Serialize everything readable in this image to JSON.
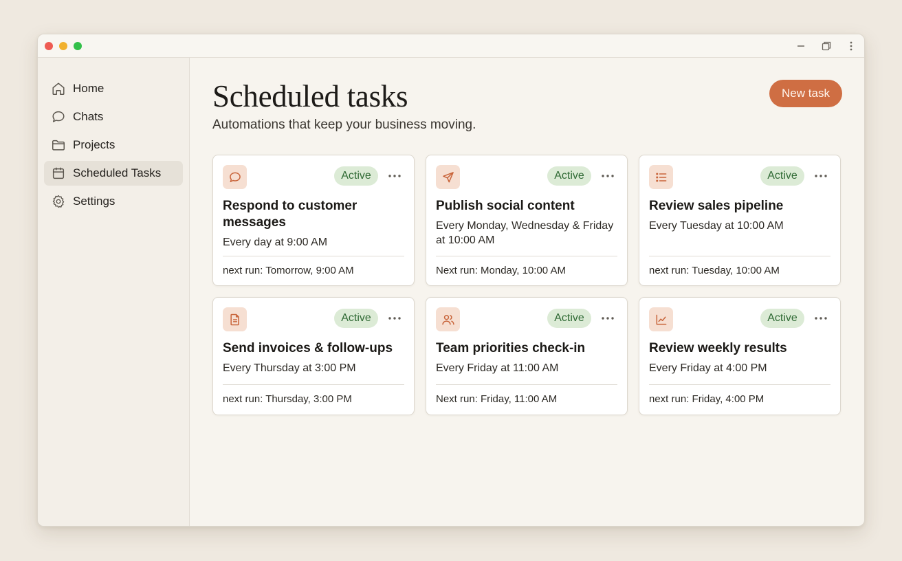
{
  "sidebar": {
    "items": [
      {
        "label": "Home",
        "icon": "home-icon",
        "active": false
      },
      {
        "label": "Chats",
        "icon": "chat-bubble-icon",
        "active": false
      },
      {
        "label": "Projects",
        "icon": "folder-icon",
        "active": false
      },
      {
        "label": "Scheduled Tasks",
        "icon": "calendar-icon",
        "active": true
      },
      {
        "label": "Settings",
        "icon": "gear-icon",
        "active": false
      }
    ]
  },
  "header": {
    "title": "Scheduled tasks",
    "subtitle": "Automations that keep your business moving.",
    "new_task_label": "New task"
  },
  "colors": {
    "accent": "#cf6e43",
    "active_badge_bg": "#dcebd6",
    "active_badge_text": "#2f6a34",
    "icon_tile_bg": "#f6dfd2"
  },
  "tasks": [
    {
      "icon": "chat-bubble-icon",
      "status": "Active",
      "title": "Respond to customer messages",
      "schedule": "Every day at 9:00 AM",
      "next_run": "next run: Tomorrow, 9:00 AM"
    },
    {
      "icon": "send-icon",
      "status": "Active",
      "title": "Publish social content",
      "schedule": "Every Monday, Wednesday & Friday at 10:00 AM",
      "next_run": "Next run: Monday, 10:00 AM"
    },
    {
      "icon": "list-icon",
      "status": "Active",
      "title": "Review sales pipeline",
      "schedule": "Every Tuesday at 10:00 AM",
      "next_run": "next run: Tuesday, 10:00 AM"
    },
    {
      "icon": "document-icon",
      "status": "Active",
      "title": "Send invoices & follow-ups",
      "schedule": "Every Thursday at 3:00 PM",
      "next_run": "next run: Thursday, 3:00 PM"
    },
    {
      "icon": "users-icon",
      "status": "Active",
      "title": "Team priorities check-in",
      "schedule": "Every Friday at 11:00 AM",
      "next_run": "Next run: Friday, 11:00 AM"
    },
    {
      "icon": "line-chart-icon",
      "status": "Active",
      "title": "Review weekly results",
      "schedule": "Every Friday at 4:00 PM",
      "next_run": "next run: Friday, 4:00 PM"
    }
  ]
}
